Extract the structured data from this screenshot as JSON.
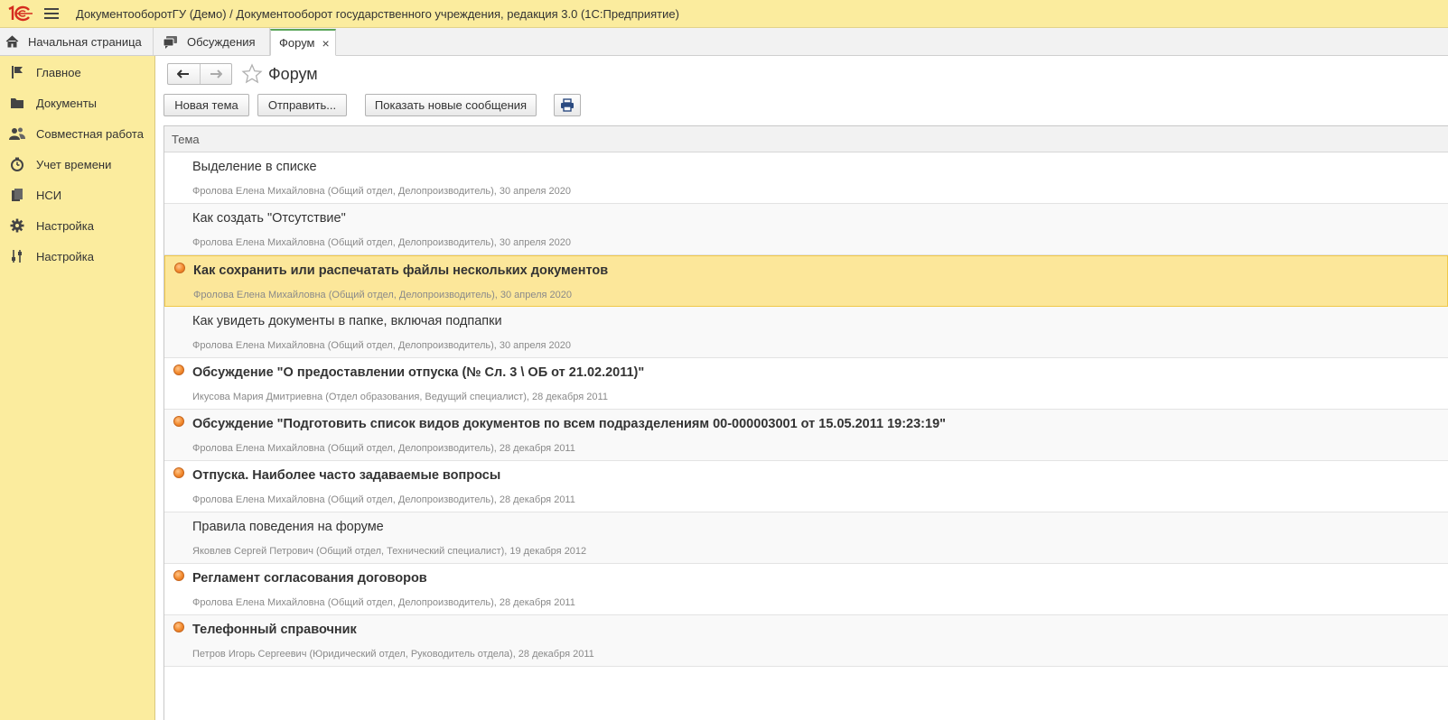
{
  "app": {
    "title": "ДокументооборотГУ (Демо) / Документооборот государственного учреждения, редакция 3.0  (1С:Предприятие)",
    "logo_text": "1С"
  },
  "tabs": [
    {
      "label": "Начальная страница",
      "icon": "home-icon"
    },
    {
      "label": "Обсуждения",
      "icon": "chat-icon"
    },
    {
      "label": "Форум",
      "close": "×"
    }
  ],
  "sidebar": {
    "items": [
      {
        "label": "Главное",
        "icon": "flag-icon"
      },
      {
        "label": "Документы",
        "icon": "folder-icon"
      },
      {
        "label": "Совместная работа",
        "icon": "users-icon"
      },
      {
        "label": "Учет времени",
        "icon": "stopwatch-icon"
      },
      {
        "label": "НСИ",
        "icon": "reference-books-icon"
      },
      {
        "label": "Настройка",
        "icon": "gear-icon"
      },
      {
        "label": "Настройка",
        "icon": "sliders-icon"
      }
    ]
  },
  "page": {
    "title": "Форум"
  },
  "toolbar": {
    "new_topic": "Новая тема",
    "send": "Отправить...",
    "show_new": "Показать новые сообщения",
    "print_icon": "printer-icon"
  },
  "list": {
    "column_header": "Тема",
    "rows": [
      {
        "topic": "Выделение в списке",
        "meta": "Фролова Елена Михайловна (Общий отдел, Делопроизводитель), 30 апреля 2020",
        "unread": false
      },
      {
        "topic": "Как создать \"Отсутствие\"",
        "meta": "Фролова Елена Михайловна (Общий отдел, Делопроизводитель), 30 апреля 2020",
        "unread": false
      },
      {
        "topic": "Как сохранить или распечатать файлы нескольких документов",
        "meta": "Фролова Елена Михайловна (Общий отдел, Делопроизводитель), 30 апреля 2020",
        "unread": true,
        "selected": true
      },
      {
        "topic": "Как увидеть документы в папке, включая подпапки",
        "meta": "Фролова Елена Михайловна (Общий отдел, Делопроизводитель), 30 апреля 2020",
        "unread": false
      },
      {
        "topic": "Обсуждение \"О предоставлении отпуска (№ Сл. 3 \\ ОБ от 21.02.2011)\"",
        "meta": "Икусова Мария Дмитриевна (Отдел образования, Ведущий специалист), 28 декабря 2011",
        "unread": true
      },
      {
        "topic": "Обсуждение \"Подготовить список видов документов по всем подразделениям 00-000003001 от 15.05.2011 19:23:19\"",
        "meta": "Фролова Елена Михайловна (Общий отдел, Делопроизводитель), 28 декабря 2011",
        "unread": true
      },
      {
        "topic": "Отпуска. Наиболее часто задаваемые вопросы",
        "meta": "Фролова Елена Михайловна (Общий отдел, Делопроизводитель), 28 декабря 2011",
        "unread": true
      },
      {
        "topic": "Правила поведения на форуме",
        "meta": "Яковлев Сергей Петрович (Общий отдел, Технический специалист), 19 декабря 2012",
        "unread": false
      },
      {
        "topic": "Регламент согласования договоров",
        "meta": "Фролова Елена Михайловна (Общий отдел, Делопроизводитель), 28 декабря 2011",
        "unread": true
      },
      {
        "topic": "Телефонный справочник",
        "meta": "Петров Игорь Сергеевич (Юридический отдел, Руководитель отдела), 28 декабря 2011",
        "unread": true
      }
    ]
  },
  "colors": {
    "panel_yellow": "#fbec9e",
    "selected_row": "#fce79a",
    "unread_dot": "#f28a2e",
    "active_tab_accent": "#5aa55a",
    "logo_red": "#d52b1e"
  }
}
